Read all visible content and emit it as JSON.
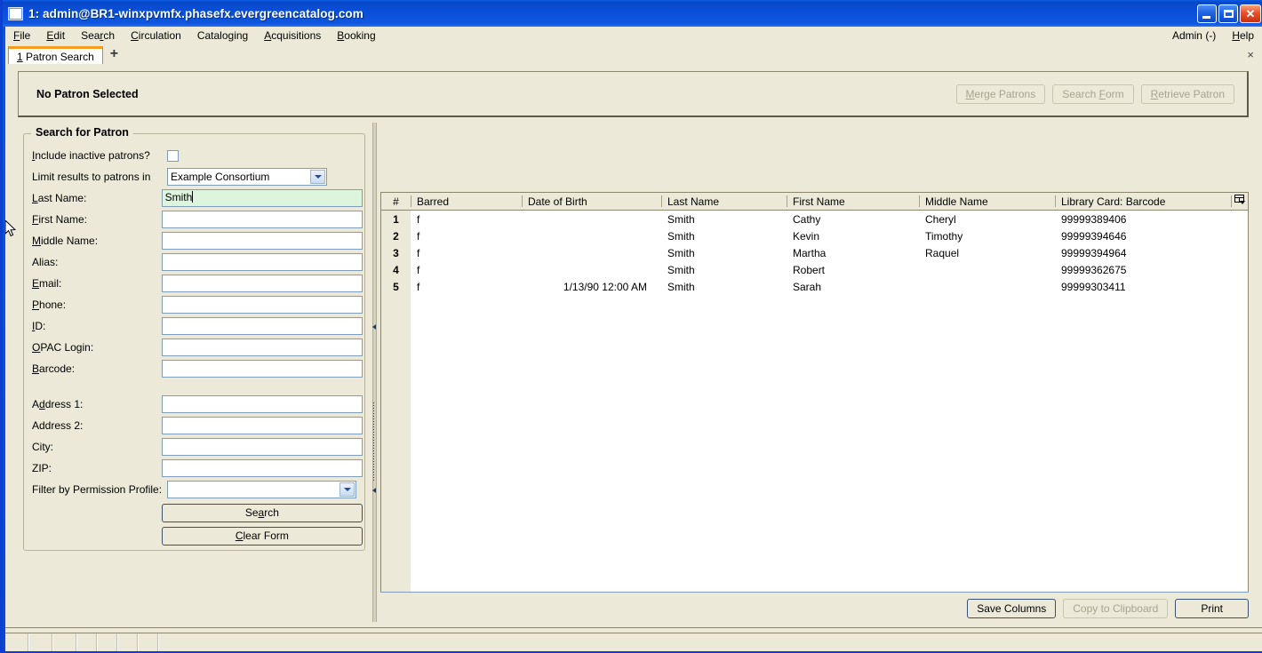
{
  "window": {
    "title": "1: admin@BR1-winxpvmfx.phasefx.evergreencatalog.com",
    "minimize_label": "",
    "maximize_label": "",
    "close_label": "✕"
  },
  "menubar": {
    "items": [
      {
        "label": "File",
        "mnemonic": "F"
      },
      {
        "label": "Edit",
        "mnemonic": "E"
      },
      {
        "label": "Search",
        "mnemonic": "r"
      },
      {
        "label": "Circulation",
        "mnemonic": "C"
      },
      {
        "label": "Cataloging",
        "mnemonic": "g"
      },
      {
        "label": "Acquisitions",
        "mnemonic": "A"
      },
      {
        "label": "Booking",
        "mnemonic": "B"
      }
    ],
    "right_items": [
      {
        "label": "Admin (-)"
      },
      {
        "label": "Help",
        "mnemonic": "H"
      }
    ]
  },
  "tabs": {
    "active": {
      "number": "1",
      "label": "Patron Search"
    },
    "add_label": "+",
    "close_label": "×"
  },
  "header": {
    "status_text": "No Patron Selected",
    "buttons": [
      {
        "label": "Merge Patrons",
        "enabled": false
      },
      {
        "label": "Search Form",
        "enabled": false
      },
      {
        "label": "Retrieve Patron",
        "enabled": false
      }
    ]
  },
  "search_panel": {
    "legend": "Search for Patron",
    "include_inactive_label": "Include inactive patrons?",
    "include_inactive_checked": false,
    "limit_results_label": "Limit results to patrons in",
    "limit_results_value": "Example Consortium",
    "fields": [
      {
        "label": "Last Name:",
        "value": "Smith",
        "focused": true
      },
      {
        "label": "First Name:",
        "value": "",
        "focused": false
      },
      {
        "label": "Middle Name:",
        "value": "",
        "focused": false
      },
      {
        "label": "Alias:",
        "value": "",
        "focused": false
      },
      {
        "label": "Email:",
        "value": "",
        "focused": false
      },
      {
        "label": "Phone:",
        "value": "",
        "focused": false
      },
      {
        "label": "ID:",
        "value": "",
        "focused": false
      },
      {
        "label": "OPAC Login:",
        "value": "",
        "focused": false
      },
      {
        "label": "Barcode:",
        "value": "",
        "focused": false
      }
    ],
    "address_fields": [
      {
        "label": "Address 1:",
        "value": ""
      },
      {
        "label": "Address 2:",
        "value": ""
      },
      {
        "label": "City:",
        "value": ""
      },
      {
        "label": "ZIP:",
        "value": ""
      }
    ],
    "permission_profile_label": "Filter by Permission Profile:",
    "permission_profile_value": "",
    "search_button": "Search",
    "clear_button": "Clear Form"
  },
  "results": {
    "columns": [
      "#",
      "Barred",
      "Date of Birth",
      "Last Name",
      "First Name",
      "Middle Name",
      "Library Card: Barcode"
    ],
    "column_picker_icon": "columns-icon",
    "rows": [
      {
        "num": "1",
        "barred": "f",
        "dob": "",
        "last": "Smith",
        "first": "Cathy",
        "middle": "Cheryl",
        "barcode": "99999389406"
      },
      {
        "num": "2",
        "barred": "f",
        "dob": "",
        "last": "Smith",
        "first": "Kevin",
        "middle": "Timothy",
        "barcode": "99999394646"
      },
      {
        "num": "3",
        "barred": "f",
        "dob": "",
        "last": "Smith",
        "first": "Martha",
        "middle": "Raquel",
        "barcode": "99999394964"
      },
      {
        "num": "4",
        "barred": "f",
        "dob": "",
        "last": "Smith",
        "first": "Robert",
        "middle": "",
        "barcode": "99999362675"
      },
      {
        "num": "5",
        "barred": "f",
        "dob": "1/13/90 12:00 AM",
        "last": "Smith",
        "first": "Sarah",
        "middle": "",
        "barcode": "99999303411"
      }
    ],
    "footer_buttons": [
      {
        "label": "Save Columns",
        "enabled": true
      },
      {
        "label": "Copy to Clipboard",
        "enabled": false
      },
      {
        "label": "Print",
        "enabled": true
      }
    ]
  },
  "colors": {
    "titlebar_blue": "#0a4ed8",
    "panel_beige": "#ece9d8",
    "active_field_green": "#ddf5dd",
    "tab_accent_orange": "#f59b1e",
    "field_border_blue": "#7f9db9"
  }
}
